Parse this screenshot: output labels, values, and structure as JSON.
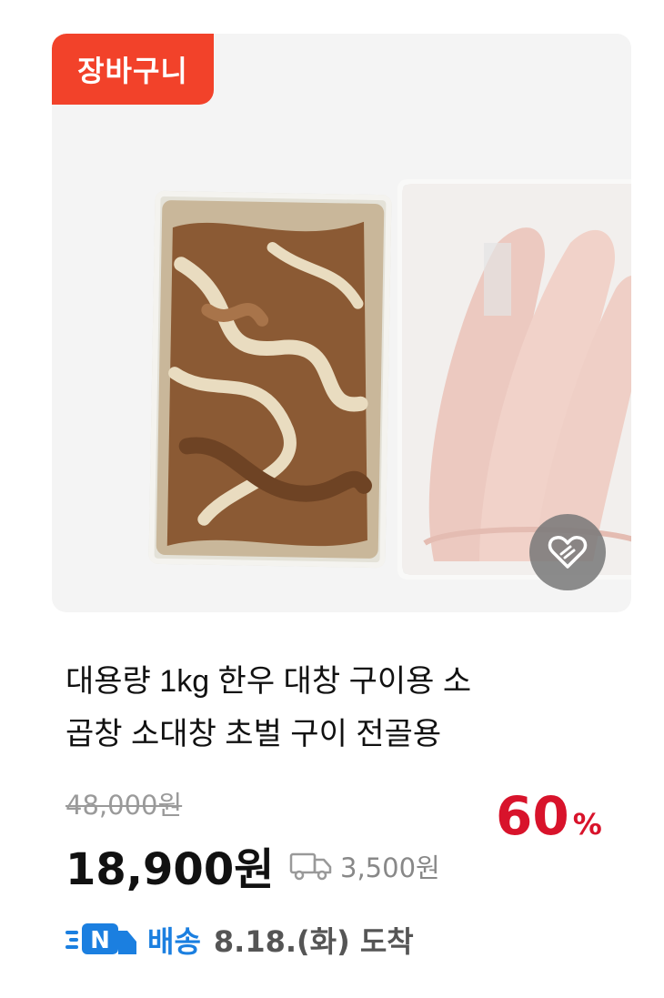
{
  "product": {
    "badge": "장바구니",
    "image_alt": "대창 곱창 포장 사진",
    "title_line1": "대용량 1kg 한우 대창 구이용 소",
    "title_line2": "곱창 소대창 초벌 구이 전골용",
    "original_price": "48,000원",
    "discount_value": "60",
    "discount_unit": "%",
    "sale_price": "18,900원",
    "shipping_fee": "3,500원",
    "delivery_service": "배송",
    "delivery_badge_letter": "N",
    "delivery_date": "8.18.(화) 도착"
  },
  "icons": {
    "wish": "heart-link-icon",
    "truck": "truck-icon",
    "delivery": "fast-delivery-truck-icon"
  },
  "colors": {
    "badge": "#f2422a",
    "discount": "#d8132b",
    "delivery": "#1b7fe0"
  }
}
